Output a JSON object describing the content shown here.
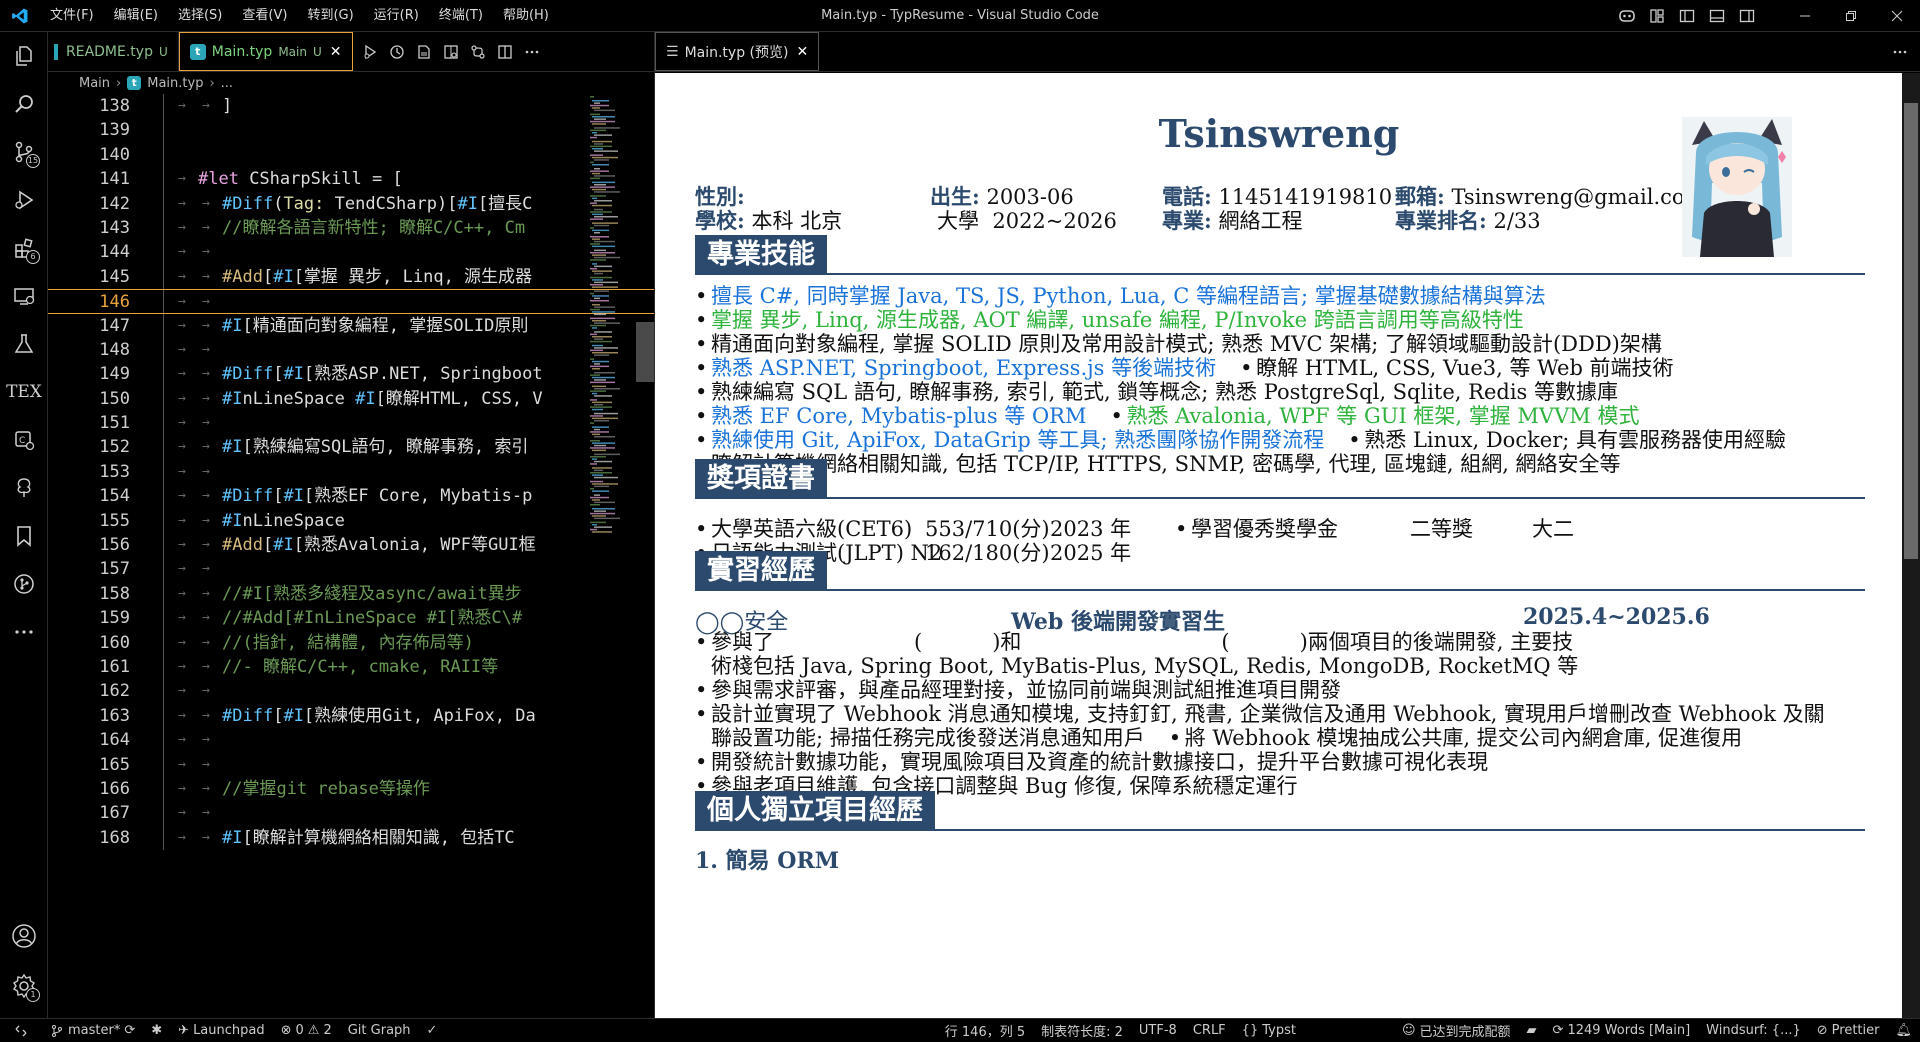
{
  "window": {
    "title": "Main.typ - TypResume - Visual Studio Code",
    "menus": [
      "文件(F)",
      "编辑(E)",
      "选择(S)",
      "查看(V)",
      "转到(G)",
      "运行(R)",
      "终端(T)",
      "帮助(H)"
    ]
  },
  "activity_bar": {
    "scm_badge": "15",
    "extensions_badge": "6",
    "tex_label": "TEX",
    "settings_badge": "1"
  },
  "editor1": {
    "tabs": [
      {
        "name": "README.typ",
        "status": "U"
      },
      {
        "name": "Main.typ",
        "desc": "Main",
        "status": "U",
        "icon_letter": "t"
      }
    ],
    "breadcrumb": [
      "Main",
      "Main.typ",
      "..."
    ],
    "lines": [
      {
        "n": "138",
        "text": "]",
        "indent": true
      },
      {
        "n": "139",
        "text": ""
      },
      {
        "n": "140",
        "text": ""
      },
      {
        "n": "141",
        "text": "#let CSharpSkill = ["
      },
      {
        "n": "142",
        "text": "#Diff(Tag: TendCSharp)[#I[擅長C",
        "indent": true
      },
      {
        "n": "143",
        "text": "//瞭解各語言新特性; 瞭解C/C++, Cm",
        "indent": true
      },
      {
        "n": "144",
        "text": "",
        "indent": true
      },
      {
        "n": "145",
        "text": "#Add[#I[掌握 異步, Linq, 源生成器",
        "indent": true
      },
      {
        "n": "146",
        "text": "",
        "indent": true,
        "current": true
      },
      {
        "n": "147",
        "text": "#I[精通面向對象編程, 掌握SOLID原則",
        "indent": true
      },
      {
        "n": "148",
        "text": "",
        "indent": true
      },
      {
        "n": "149",
        "text": "#Diff[#I[熟悉ASP.NET, Springboot",
        "indent": true
      },
      {
        "n": "150",
        "text": "#InLineSpace #I[瞭解HTML, CSS, V",
        "indent": true
      },
      {
        "n": "151",
        "text": "",
        "indent": true
      },
      {
        "n": "152",
        "text": "#I[熟練編寫SQL語句, 瞭解事務, 索引",
        "indent": true
      },
      {
        "n": "153",
        "text": "",
        "indent": true
      },
      {
        "n": "154",
        "text": "#Diff[#I[熟悉EF Core, Mybatis-p",
        "indent": true
      },
      {
        "n": "155",
        "text": "#InLineSpace",
        "indent": true
      },
      {
        "n": "156",
        "text": "#Add[#I[熟悉Avalonia, WPF等GUI框",
        "indent": true
      },
      {
        "n": "157",
        "text": "",
        "indent": true
      },
      {
        "n": "158",
        "text": "//#I[熟悉多綫程及async/await異步",
        "indent": true
      },
      {
        "n": "159",
        "text": "//#Add[#InLineSpace #I[熟悉C\\#",
        "indent": true
      },
      {
        "n": "160",
        "text": "//(指針, 結構體, 內存佈局等)",
        "indent": true
      },
      {
        "n": "161",
        "text": "//- 瞭解C/C++, cmake, RAII等",
        "indent": true
      },
      {
        "n": "162",
        "text": "",
        "indent": true
      },
      {
        "n": "163",
        "text": "#Diff[#I[熟練使用Git, ApiFox, Da",
        "indent": true
      },
      {
        "n": "164",
        "text": "",
        "indent": true
      },
      {
        "n": "165",
        "text": "",
        "indent": true
      },
      {
        "n": "166",
        "text": "//掌握git rebase等操作",
        "indent": true
      },
      {
        "n": "167",
        "text": "",
        "indent": true
      },
      {
        "n": "168",
        "text": "#I[瞭解計算機網絡相關知識, 包括TC",
        "indent": true
      }
    ]
  },
  "editor2": {
    "tab": "Main.typ (预览)"
  },
  "resume": {
    "name": "Tsinswreng",
    "info": [
      {
        "k": "性別",
        "v": ""
      },
      {
        "k": "出生",
        "v": "2003-06"
      },
      {
        "k": "電話",
        "v": "1145141919810"
      },
      {
        "k": "郵箱",
        "v": "Tsinswreng@gmail.com"
      },
      {
        "k": "學校",
        "v": "本科 北京"
      },
      {
        "k": "",
        "v": "大學  2022~2026"
      },
      {
        "k": "專業",
        "v": "網絡工程"
      },
      {
        "k": "專業排名",
        "v": "2/33"
      }
    ],
    "sections": {
      "skills": "專業技能",
      "awards": "獎項證書",
      "intern": "實習經歷",
      "projects": "個人獨立項目經歷"
    },
    "skills": [
      {
        "t": "擅長 C#, 同時掌握 Java, TS, JS, Python, Lua, C 等編程語言; 掌握基礎數據結構與算法",
        "c": "blue"
      },
      {
        "t": "掌握 異步, Linq, 源生成器, AOT 編譯, unsafe 編程, P/Invoke 跨語言調用等高級特性",
        "c": "green"
      },
      {
        "t": "精通面向對象編程, 掌握 SOLID 原則及常用設計模式; 熟悉 MVC 架構; 了解領域驅動設計(DDD)架構",
        "c": "black"
      },
      {
        "t": "熟悉 ASP.NET, Springboot, Express.js 等後端技術",
        "c": "blue",
        "t2": "瞭解 HTML, CSS, Vue3, 等 Web 前端技術",
        "c2": "black"
      },
      {
        "t": "熟練編寫 SQL 語句, 瞭解事務, 索引, 範式, 鎖等概念; 熟悉 PostgreSql, Sqlite, Redis 等數據庫",
        "c": "black"
      },
      {
        "t": "熟悉 EF Core, Mybatis-plus 等 ORM",
        "c": "blue",
        "t2": "熟悉 Avalonia, WPF 等 GUI 框架, 掌握 MVVM 模式",
        "c2": "green"
      },
      {
        "t": "熟練使用 Git, ApiFox, DataGrip 等工具; 熟悉團隊協作開發流程",
        "c": "blue",
        "t2": "熟悉 Linux, Docker; 具有雲服務器使用經驗",
        "c2": "black"
      },
      {
        "t": "瞭解計算機網絡相關知識, 包括 TCP/IP, HTTPS, SNMP, 密碼學, 代理, 區塊鏈, 組網, 網絡安全等",
        "c": "black"
      }
    ],
    "certs": [
      {
        "name": "大學英語六級(CET6)",
        "score": "553/710(分)",
        "year": "2023 年"
      },
      {
        "name": "日語能力測試(JLPT) N2",
        "score": "162/180(分)",
        "year": "2025 年"
      }
    ],
    "award": {
      "name": "學習優秀獎學金",
      "level": "二等獎",
      "year": "大二"
    },
    "intern": {
      "company": "◯◯安全",
      "role": "Web 後端開發實習生",
      "period": "2025.4~2025.6",
      "bullets": [
        [
          "參與了",
          "(",
          ")和",
          "(",
          ")兩個項目的後端開發, 主要技"
        ],
        "術棧包括 Java, Spring Boot, MyBatis-Plus, MySQL, Redis, MongoDB, RocketMQ 等",
        "參與需求評審，與產品經理對接，並協同前端與測試組推進項目開發",
        "設計並實現了 Webhook 消息通知模塊, 支持釘釘, 飛書, 企業微信及通用 Webhook, 實現用戶增刪改查 Webhook 及關",
        "聯設置功能; 掃描任務完成後發送消息通知用戶",
        "將 Webhook 模塊抽成公共庫, 提交公司內網倉庫, 促進復用",
        "開發統計數據功能，實現風險項目及資產的統計數據接口，提升平台數據可視化表現",
        "參與老項目維護, 包含接口調整與 Bug 修復, 保障系統穩定運行"
      ]
    },
    "project1": "1. 簡易 ORM"
  },
  "statusbar": {
    "branch": "master*",
    "launchpad": "Launchpad",
    "errors": "0",
    "warnings": "2",
    "git_graph": "Git Graph",
    "position": "行 146，列 5",
    "tab_size": "制表符长度: 2",
    "encoding": "UTF-8",
    "eol": "CRLF",
    "language": "Typst",
    "completion": "已达到完成配额",
    "words": "1249 Words [Main]",
    "windsurf": "Windsurf: {...}",
    "prettier": "Prettier"
  }
}
